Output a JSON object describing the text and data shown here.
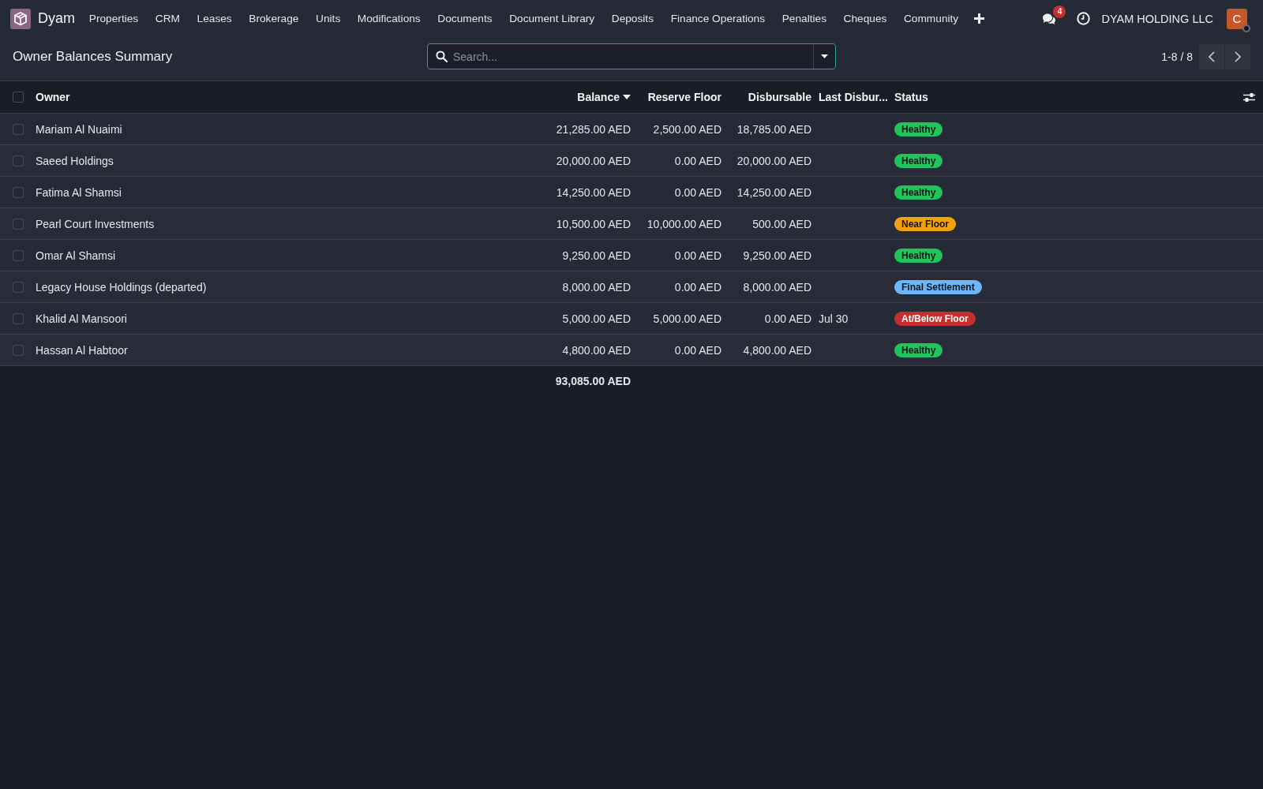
{
  "navbar": {
    "app_name": "Dyam",
    "menu": [
      {
        "label": "Properties"
      },
      {
        "label": "CRM"
      },
      {
        "label": "Leases"
      },
      {
        "label": "Brokerage"
      },
      {
        "label": "Units"
      },
      {
        "label": "Modifications"
      },
      {
        "label": "Documents"
      },
      {
        "label": "Document Library"
      },
      {
        "label": "Deposits"
      },
      {
        "label": "Finance Operations"
      },
      {
        "label": "Penalties"
      },
      {
        "label": "Cheques"
      },
      {
        "label": "Community"
      }
    ],
    "messages_badge": "4",
    "company": "DYAM HOLDING LLC",
    "avatar": {
      "initial": "C",
      "online": false
    }
  },
  "control_panel": {
    "title": "Owner Balances Summary",
    "search": {
      "placeholder": "Search..."
    },
    "pager": "1-8 / 8"
  },
  "table": {
    "all_selected": false,
    "columns": [
      {
        "label": "Owner",
        "kind": "text",
        "sorted": false
      },
      {
        "label": "Balance",
        "kind": "money",
        "sorted": true
      },
      {
        "label": "Reserve Floor",
        "kind": "money",
        "sorted": false
      },
      {
        "label": "Disbursable",
        "kind": "money",
        "sorted": false
      },
      {
        "label": "Last Disbur...",
        "kind": "text",
        "sorted": false
      },
      {
        "label": "Status",
        "kind": "status",
        "sorted": false
      }
    ],
    "rows": [
      {
        "selected": false,
        "owner": "Mariam Al Nuaimi",
        "balance": "21,285.00 AED",
        "reserve_floor": "2,500.00 AED",
        "disbursable": "18,785.00 AED",
        "status": {
          "label": "Healthy",
          "color": "#22c35c"
        }
      },
      {
        "selected": false,
        "owner": "Saeed Holdings",
        "balance": "20,000.00 AED",
        "reserve_floor": "0.00 AED",
        "disbursable": "20,000.00 AED",
        "status": {
          "label": "Healthy",
          "color": "#22c35c"
        }
      },
      {
        "selected": false,
        "owner": "Fatima Al Shamsi",
        "balance": "14,250.00 AED",
        "reserve_floor": "0.00 AED",
        "disbursable": "14,250.00 AED",
        "status": {
          "label": "Healthy",
          "color": "#22c35c"
        }
      },
      {
        "selected": false,
        "owner": "Pearl Court Investments",
        "balance": "10,500.00 AED",
        "reserve_floor": "10,000.00 AED",
        "disbursable": "500.00 AED",
        "status": {
          "label": "Near Floor",
          "color": "#f0a10c"
        }
      },
      {
        "selected": false,
        "owner": "Omar Al Shamsi",
        "balance": "9,250.00 AED",
        "reserve_floor": "0.00 AED",
        "disbursable": "9,250.00 AED",
        "status": {
          "label": "Healthy",
          "color": "#22c35c"
        }
      },
      {
        "selected": false,
        "owner": "Legacy House Holdings (departed)",
        "balance": "8,000.00 AED",
        "reserve_floor": "0.00 AED",
        "disbursable": "8,000.00 AED",
        "status": {
          "label": "Final Settlement",
          "color": "#6cb6fb"
        }
      },
      {
        "selected": false,
        "owner": "Khalid Al Mansoori",
        "balance": "5,000.00 AED",
        "reserve_floor": "5,000.00 AED",
        "disbursable": "0.00 AED",
        "last_disbursement": "Jul 30",
        "status": {
          "label": "At/Below Floor",
          "color": "#c62f2f"
        }
      },
      {
        "selected": false,
        "owner": "Hassan Al Habtoor",
        "balance": "4,800.00 AED",
        "reserve_floor": "0.00 AED",
        "disbursable": "4,800.00 AED",
        "status": {
          "label": "Healthy",
          "color": "#22c35c"
        }
      }
    ],
    "totals": {
      "balance": "93,085.00 AED"
    }
  }
}
